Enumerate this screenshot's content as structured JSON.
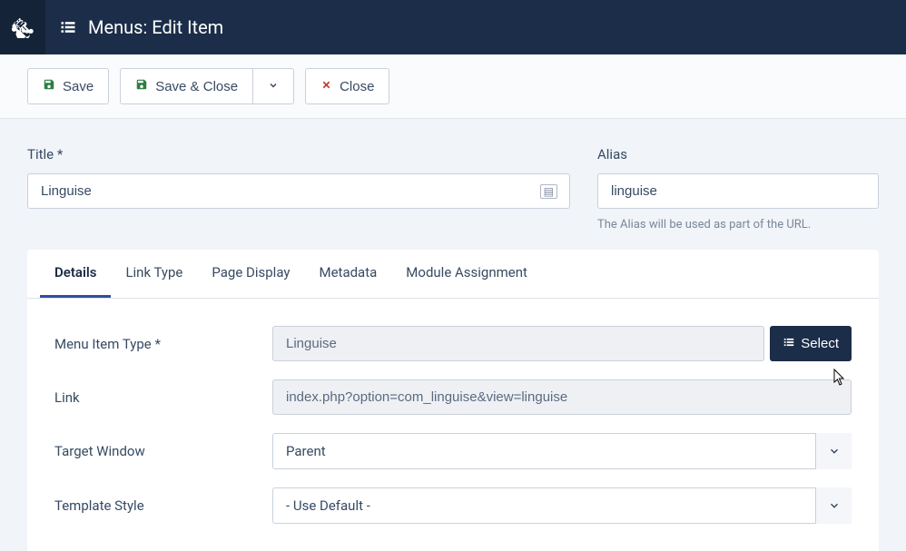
{
  "header": {
    "title": "Menus: Edit Item"
  },
  "toolbar": {
    "save": "Save",
    "save_close": "Save & Close",
    "close": "Close"
  },
  "title_field": {
    "label": "Title *",
    "value": "Linguise"
  },
  "alias_field": {
    "label": "Alias",
    "value": "linguise",
    "help": "The Alias will be used as part of the URL."
  },
  "tabs": {
    "details": "Details",
    "link_type": "Link Type",
    "page_display": "Page Display",
    "metadata": "Metadata",
    "module_assignment": "Module Assignment"
  },
  "form": {
    "menu_item_type": {
      "label": "Menu Item Type *",
      "value": "Linguise",
      "select_btn": "Select"
    },
    "link": {
      "label": "Link",
      "value": "index.php?option=com_linguise&view=linguise"
    },
    "target_window": {
      "label": "Target Window",
      "value": "Parent"
    },
    "template_style": {
      "label": "Template Style",
      "value": "- Use Default -"
    }
  }
}
